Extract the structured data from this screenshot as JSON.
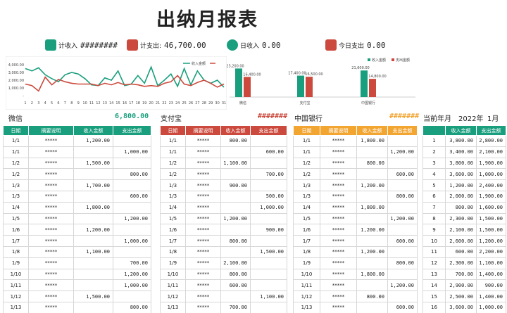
{
  "title": "出纳月报表",
  "kpis": [
    {
      "label": "计收入",
      "value": "########",
      "color": "#1a9f7e",
      "icon": "coins-icon"
    },
    {
      "label": "计支出:",
      "value": "46,700.00",
      "color": "#cc4a3d",
      "icon": "stack-icon"
    },
    {
      "label": "日收入",
      "value": "0.00",
      "color": "#1a9f7e",
      "icon": "check-circle-icon"
    },
    {
      "label": "今日支出",
      "value": "0.00",
      "color": "#cc4a3d",
      "icon": "grid-icon"
    }
  ],
  "chart_data": [
    {
      "type": "line",
      "title": "",
      "x": [
        1,
        2,
        3,
        4,
        5,
        6,
        7,
        8,
        9,
        10,
        11,
        12,
        13,
        14,
        15,
        16,
        17,
        18,
        19,
        20,
        21,
        22,
        23,
        24,
        25,
        26,
        27,
        28,
        29,
        30,
        31
      ],
      "ylim": [
        0,
        4000
      ],
      "yticks": [
        "4,000.00",
        "3,000.00",
        "2,000.00",
        "1,000.00",
        "-"
      ],
      "series": [
        {
          "name": "收入金额",
          "color": "#1a9f7e",
          "values": [
            3500,
            3200,
            3600,
            2700,
            2200,
            1800,
            2700,
            3000,
            2800,
            2200,
            1400,
            1300,
            2300,
            2000,
            3200,
            1300,
            1500,
            2600,
            1600,
            3700,
            1300,
            2000,
            2800,
            1200,
            3500,
            1400,
            3200,
            2000,
            1600,
            2000,
            1100
          ]
        },
        {
          "name": "",
          "color": "#cc4a3d",
          "values": [
            1500,
            1300,
            600,
            2400,
            1400,
            2100,
            1800,
            1600,
            1500,
            1500,
            1500,
            1300,
            1600,
            1400,
            1700,
            1400,
            1500,
            1400,
            1200,
            1300,
            1200,
            1600,
            1800,
            2600,
            1500,
            1300,
            1700,
            2000,
            1600,
            1100,
            1500
          ]
        }
      ]
    },
    {
      "type": "bar",
      "title": "",
      "categories": [
        "微信",
        "支付宝",
        "中国银行"
      ],
      "ylim": [
        0,
        24000
      ],
      "series": [
        {
          "name": "收入金额",
          "color": "#1a9f7e",
          "values": [
            23200,
            17400,
            21600
          ]
        },
        {
          "name": "支出金额",
          "color": "#cc4a3d",
          "values": [
            16400,
            16500,
            14800
          ]
        }
      ],
      "labels": [
        [
          "23,200.00",
          "16,400.00"
        ],
        [
          "17,400.00",
          "16,500.00"
        ],
        [
          "21,600.00",
          "14,800.00"
        ]
      ]
    }
  ],
  "sections": [
    {
      "name": "微信",
      "total": "6,800.00"
    },
    {
      "name": "支付宝",
      "total": "#######"
    },
    {
      "name": "中国银行",
      "total": "#######"
    }
  ],
  "period": {
    "label": "当前年月",
    "year": "2022年",
    "month": "1月"
  },
  "headers": [
    "日期",
    "摘要说明",
    "收入金额",
    "支出金额"
  ],
  "wechat": [
    [
      "1/1",
      "*****",
      "1,200.00",
      ""
    ],
    [
      "1/1",
      "*****",
      "",
      "1,000.00"
    ],
    [
      "1/2",
      "*****",
      "1,500.00",
      ""
    ],
    [
      "1/2",
      "*****",
      "",
      "800.00"
    ],
    [
      "1/3",
      "*****",
      "1,700.00",
      ""
    ],
    [
      "1/3",
      "*****",
      "",
      "600.00"
    ],
    [
      "1/4",
      "*****",
      "1,800.00",
      ""
    ],
    [
      "1/5",
      "*****",
      "",
      "1,200.00"
    ],
    [
      "1/6",
      "*****",
      "1,200.00",
      ""
    ],
    [
      "1/7",
      "*****",
      "",
      "1,000.00"
    ],
    [
      "1/8",
      "*****",
      "1,100.00",
      ""
    ],
    [
      "1/9",
      "*****",
      "",
      "700.00"
    ],
    [
      "1/10",
      "*****",
      "",
      "1,200.00"
    ],
    [
      "1/11",
      "*****",
      "",
      "1,000.00"
    ],
    [
      "1/12",
      "*****",
      "1,500.00",
      ""
    ],
    [
      "1/13",
      "*****",
      "",
      "800.00"
    ]
  ],
  "alipay": [
    [
      "1/1",
      "*****",
      "800.00",
      ""
    ],
    [
      "1/1",
      "*****",
      "",
      "600.00"
    ],
    [
      "1/2",
      "*****",
      "1,100.00",
      ""
    ],
    [
      "1/2",
      "*****",
      "",
      "700.00"
    ],
    [
      "1/3",
      "*****",
      "900.00",
      ""
    ],
    [
      "1/3",
      "*****",
      "",
      "500.00"
    ],
    [
      "1/4",
      "*****",
      "",
      "1,000.00"
    ],
    [
      "1/5",
      "*****",
      "1,200.00",
      ""
    ],
    [
      "1/6",
      "*****",
      "",
      "900.00"
    ],
    [
      "1/7",
      "*****",
      "800.00",
      ""
    ],
    [
      "1/8",
      "*****",
      "",
      "1,500.00"
    ],
    [
      "1/9",
      "*****",
      "2,100.00",
      ""
    ],
    [
      "1/10",
      "*****",
      "800.00",
      ""
    ],
    [
      "1/11",
      "*****",
      "600.00",
      ""
    ],
    [
      "1/12",
      "*****",
      "",
      "1,100.00"
    ],
    [
      "1/13",
      "*****",
      "700.00",
      ""
    ]
  ],
  "boc": [
    [
      "1/1",
      "*****",
      "1,800.00",
      ""
    ],
    [
      "1/1",
      "*****",
      "",
      "1,200.00"
    ],
    [
      "1/2",
      "*****",
      "800.00",
      ""
    ],
    [
      "1/2",
      "*****",
      "",
      "600.00"
    ],
    [
      "1/3",
      "*****",
      "1,200.00",
      ""
    ],
    [
      "1/3",
      "*****",
      "",
      "800.00"
    ],
    [
      "1/4",
      "*****",
      "1,800.00",
      ""
    ],
    [
      "1/5",
      "*****",
      "",
      "1,200.00"
    ],
    [
      "1/6",
      "*****",
      "1,200.00",
      ""
    ],
    [
      "1/7",
      "*****",
      "",
      "600.00"
    ],
    [
      "1/8",
      "*****",
      "1,200.00",
      ""
    ],
    [
      "1/9",
      "*****",
      "",
      "800.00"
    ],
    [
      "1/10",
      "*****",
      "1,800.00",
      ""
    ],
    [
      "1/11",
      "*****",
      "",
      "1,200.00"
    ],
    [
      "1/12",
      "*****",
      "800.00",
      ""
    ],
    [
      "1/13",
      "*****",
      "",
      "600.00"
    ]
  ],
  "summary": [
    [
      "1",
      "3,800.00",
      "2,800.00"
    ],
    [
      "2",
      "3,400.00",
      "2,100.00"
    ],
    [
      "3",
      "3,800.00",
      "1,900.00"
    ],
    [
      "4",
      "3,600.00",
      "1,000.00"
    ],
    [
      "5",
      "1,200.00",
      "2,400.00"
    ],
    [
      "6",
      "2,000.00",
      "1,900.00"
    ],
    [
      "7",
      "800.00",
      "1,600.00"
    ],
    [
      "8",
      "2,300.00",
      "1,500.00"
    ],
    [
      "9",
      "2,100.00",
      "1,500.00"
    ],
    [
      "10",
      "2,600.00",
      "1,200.00"
    ],
    [
      "11",
      "600.00",
      "2,200.00"
    ],
    [
      "12",
      "2,300.00",
      "1,100.00"
    ],
    [
      "13",
      "700.00",
      "1,400.00"
    ],
    [
      "14",
      "2,900.00",
      "900.00"
    ],
    [
      "15",
      "2,500.00",
      "1,400.00"
    ],
    [
      "16",
      "3,600.00",
      "1,000.00"
    ]
  ]
}
